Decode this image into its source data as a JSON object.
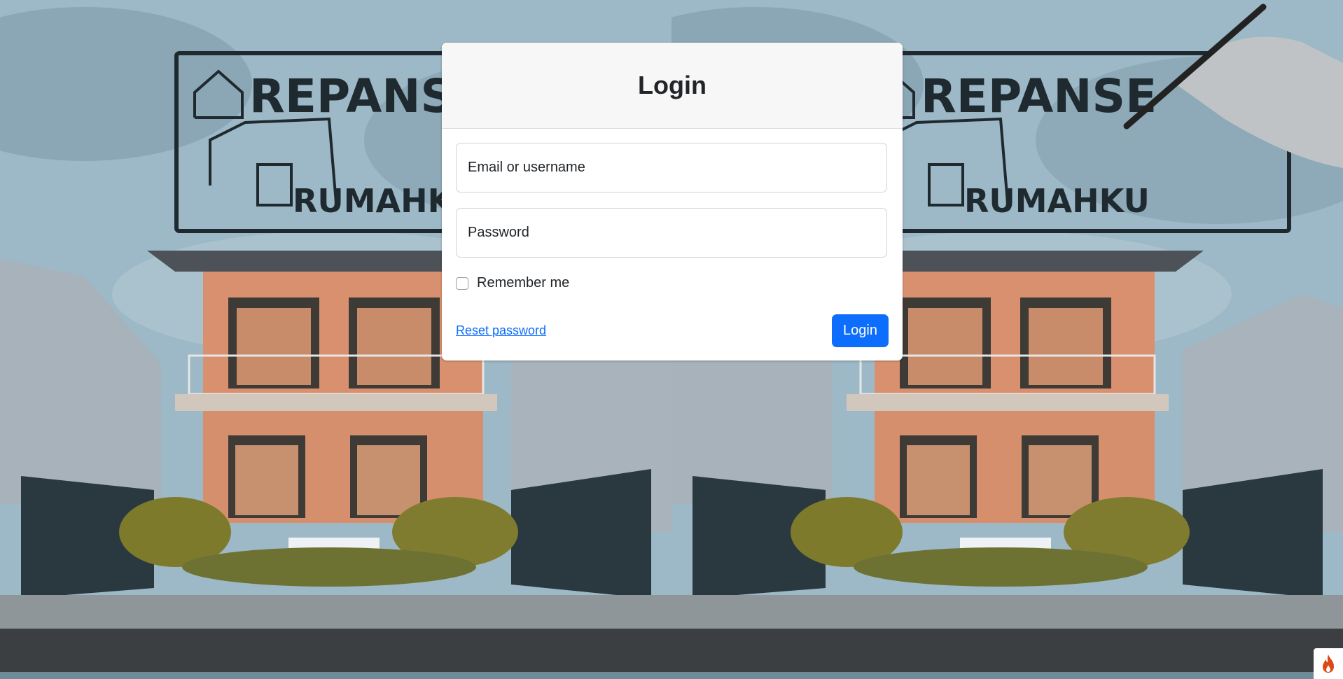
{
  "background": {
    "logo_top": "REPANSE",
    "logo_bottom": "RUMAHKU"
  },
  "login_card": {
    "title": "Login",
    "email_placeholder": "Email or username",
    "password_placeholder": "Password",
    "remember_label": "Remember me",
    "remember_checked": false,
    "reset_link": "Reset password",
    "submit_label": "Login",
    "accent_color": "#0d6efd"
  },
  "corner_badge": {
    "icon": "flame-icon",
    "color": "#dd4814"
  }
}
